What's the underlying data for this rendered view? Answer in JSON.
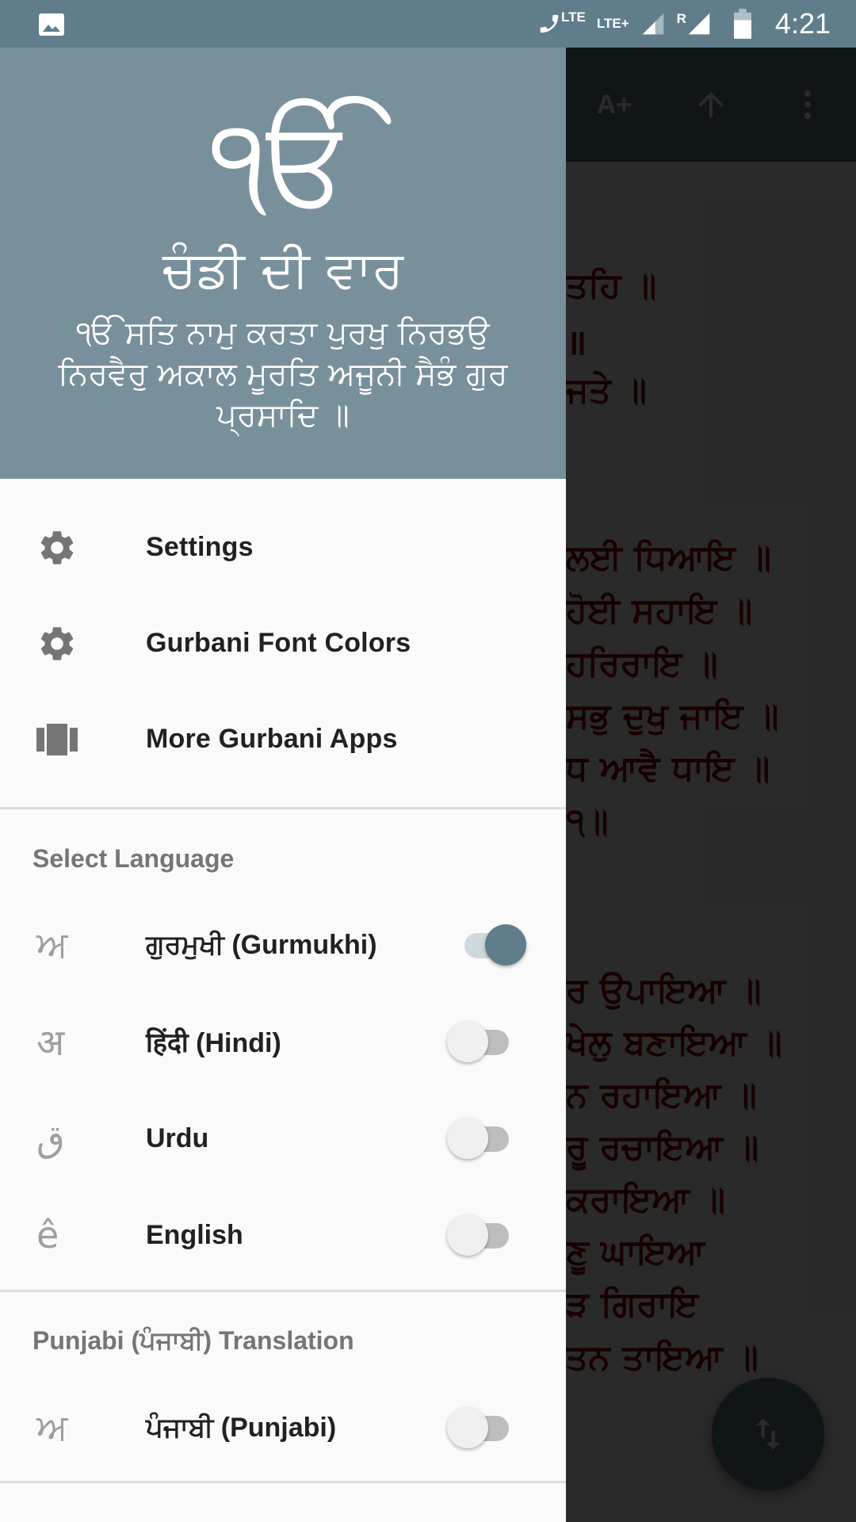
{
  "status_bar": {
    "time": "4:21",
    "call_lte": "LTE",
    "network": "LTE+",
    "roaming": "R",
    "icons": [
      "image-notification-icon",
      "volte-call-icon",
      "signal-icon",
      "signal-roaming-icon",
      "battery-icon"
    ]
  },
  "toolbar": {
    "font_size_label": "A+",
    "icons": [
      "font-increase-icon",
      "arrow-up-icon",
      "more-vert-icon"
    ]
  },
  "background_content": {
    "lines": [
      "ਤਹਿ ॥",
      "॥",
      "ਜਤੇ ॥",
      "ਲਈ ਧਿਆਇ ॥",
      "ਹੋਈ ਸਹਾਇ ॥",
      "ਹਰਿਰਾਇ ॥",
      "ਸਭੁ ਦੁਖੁ ਜਾਇ ॥",
      "ਧ ਆਵੈ ਧਾਇ ॥",
      "੧॥",
      "ਰ ਉਪਾਇਆ ॥",
      "ਖੇਲੁ ਬਣਾਇਆ ॥",
      "ਨ ਰਹਾਇਆ ॥",
      "ਰੂ ਰਚਾਇਆ ॥",
      "ਕਰਾਇਆ ॥",
      "ਣੂ ਘਾਇਆ",
      "ੜ ਗਿਰਾਇ",
      "ਤਨ ਤਾਇਆ ॥"
    ],
    "text_color": "#8b0000"
  },
  "fab": {
    "icon": "swap-vert-icon"
  },
  "drawer": {
    "header": {
      "symbol": "ੴ",
      "title": "ਚੰਡੀ ਦੀ ਵਾਰ",
      "mool_mantar": "ੴ ਸਤਿ ਨਾਮੁ ਕਰਤਾ ਪੁਰਖੁ ਨਿਰਭਉ ਨਿਰਵੈਰੁ ਅਕਾਲ ਮੂਰਤਿ ਅਜੂਨੀ ਸੈਭੰ ਗੁਰ ਪ੍ਰਸਾਦਿ ॥"
    },
    "menu_items": [
      {
        "label": "Settings",
        "icon": "settings-icon"
      },
      {
        "label": "Gurbani Font Colors",
        "icon": "settings-icon"
      },
      {
        "label": "More Gurbani Apps",
        "icon": "view-carousel-icon"
      }
    ],
    "select_language": {
      "header": "Select Language",
      "items": [
        {
          "glyph": "ਅ",
          "label": "ਗੁਰਮੁਖੀ (Gurmukhi)",
          "enabled": true
        },
        {
          "glyph": "अ",
          "label": "हिंदी (Hindi)",
          "enabled": false
        },
        {
          "glyph": "ق",
          "label": "Urdu",
          "enabled": false
        },
        {
          "glyph": "ê",
          "label": "English",
          "enabled": false
        }
      ]
    },
    "punjabi_translation": {
      "header": "Punjabi (ਪੰਜਾਬੀ) Translation",
      "items": [
        {
          "glyph": "ਅ",
          "label": "ਪੰਜਾਬੀ (Punjabi)",
          "enabled": false
        }
      ]
    }
  },
  "colors": {
    "primary": "#607d8b",
    "header_bg": "#78909c",
    "drawer_bg": "#fafafa",
    "toggle_on": "#607d8b"
  }
}
